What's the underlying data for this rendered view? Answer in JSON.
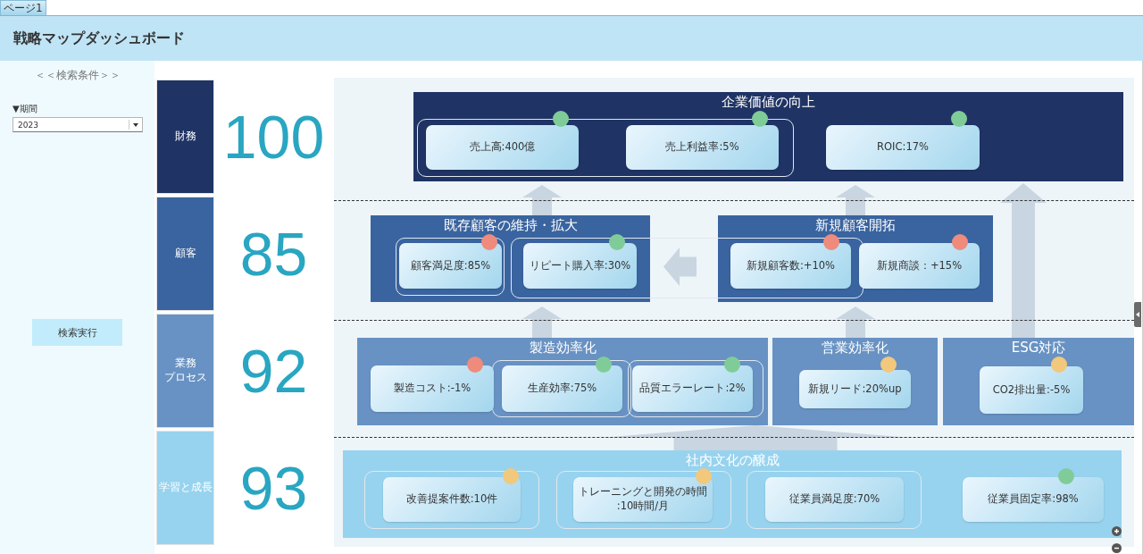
{
  "tabs": [
    {
      "label": "ページ1",
      "selected": true
    }
  ],
  "header": {
    "title": "戦略マップダッシュボード"
  },
  "search_panel": {
    "heading": "＜＜検索条件＞＞",
    "period_label": "▼期間",
    "period": {
      "value": "2023"
    },
    "search_button": "検索実行"
  },
  "perspectives": [
    {
      "label_lines": [
        "財務"
      ],
      "score": "100",
      "color": "#1f3464",
      "objectives": [
        {
          "title": "企業価値の向上",
          "kpis": [
            {
              "label": "売上高:400億",
              "color": "#80cc98"
            },
            {
              "label": "売上利益率:5%",
              "color": "#80cc98"
            },
            {
              "label": "ROIC:17%",
              "color": "#80cc98"
            }
          ]
        }
      ]
    },
    {
      "label_lines": [
        "顧客"
      ],
      "score": "85",
      "color": "#3a64a0",
      "objectives": [
        {
          "title": "既存顧客の維持・拡大",
          "kpis": [
            {
              "label": "顧客満足度:85%",
              "color": "#ee8b7d"
            },
            {
              "label": "リピート購入率:30%",
              "color": "#80cc98"
            }
          ]
        },
        {
          "title": "新規顧客開拓",
          "kpis": [
            {
              "label": "新規顧客数:+10%",
              "color": "#ee8b7d"
            },
            {
              "label": "新規商談：+15%",
              "color": "#ee8b7d"
            }
          ]
        }
      ]
    },
    {
      "label_lines": [
        "業務",
        "プロセス"
      ],
      "score": "92",
      "color": "#6892c3",
      "objectives": [
        {
          "title": "製造効率化",
          "kpis": [
            {
              "label": "製造コスト:-1%",
              "color": "#ee8b7d"
            },
            {
              "label": "生産効率:75%",
              "color": "#80cc98"
            },
            {
              "label": "品質エラーレート:2%",
              "color": "#80cc98"
            }
          ]
        },
        {
          "title": "営業効率化",
          "kpis": [
            {
              "label": "新規リード:20%up",
              "color": "#f2c87c"
            }
          ]
        },
        {
          "title": "ESG対応",
          "kpis": [
            {
              "label": "CO2排出量:-5%",
              "color": "#f2c87c"
            }
          ]
        }
      ]
    },
    {
      "label_lines": [
        "学習と成長"
      ],
      "score": "93",
      "color": "#97d3ee",
      "objectives": [
        {
          "title": "社内文化の醸成",
          "kpis": [
            {
              "label": "改善提案件数:10件",
              "color": "#f2c87c"
            },
            {
              "label": "トレーニングと開発の時間\n:10時間/月",
              "color": "#f2c87c"
            },
            {
              "label": "従業員満足度:70%"
            },
            {
              "label": "従業員固定率:98%",
              "color": "#80cc98"
            }
          ]
        }
      ]
    }
  ]
}
